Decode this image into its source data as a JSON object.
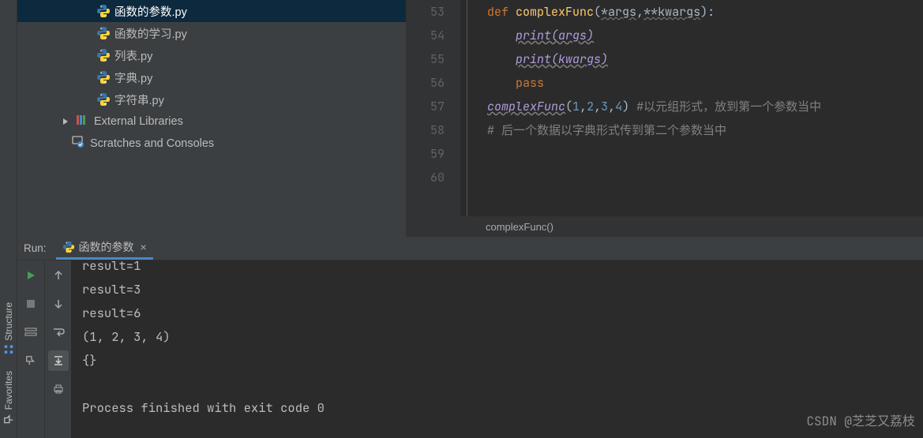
{
  "sidebar": {
    "labels": {
      "structure": "Structure",
      "favorites": "Favorites"
    }
  },
  "tree": {
    "items": [
      {
        "label": "函数的参数.py",
        "kind": "py",
        "selected": true
      },
      {
        "label": "函数的学习.py",
        "kind": "py",
        "selected": false
      },
      {
        "label": "列表.py",
        "kind": "py",
        "selected": false
      },
      {
        "label": "字典.py",
        "kind": "py",
        "selected": false
      },
      {
        "label": "字符串.py",
        "kind": "py",
        "selected": false
      }
    ],
    "external": "External Libraries",
    "scratches": "Scratches and Consoles"
  },
  "code": {
    "lines": [
      53,
      54,
      55,
      56,
      57,
      58,
      59,
      60
    ],
    "l53_def": "def ",
    "l53_fn": "complexFunc",
    "l53_open": "(",
    "l53_args": "*args",
    "l53_comma": ",",
    "l53_kwargs": "**kwargs",
    "l53_close": "):",
    "l54": "print(args)",
    "l55": "print(kwargs)",
    "l56": "pass",
    "l57_call": "complexFunc",
    "l57_args": "(1,2,3,4)",
    "l57_n1": "1",
    "l57_n2": "2",
    "l57_n3": "3",
    "l57_n4": "4",
    "l57_cm": "#以元组形式，放到第一个参数当中",
    "l58": "# 后一个数据以字典形式传到第二个参数当中"
  },
  "breadcrumb": "complexFunc()",
  "run": {
    "panel_label": "Run:",
    "tab_label": "函数的参数",
    "output": [
      "result=1",
      "result=3",
      "result=6",
      "(1, 2, 3, 4)",
      "{}",
      "",
      "Process finished with exit code 0"
    ]
  },
  "watermark": "CSDN @芝芝又荔枝"
}
